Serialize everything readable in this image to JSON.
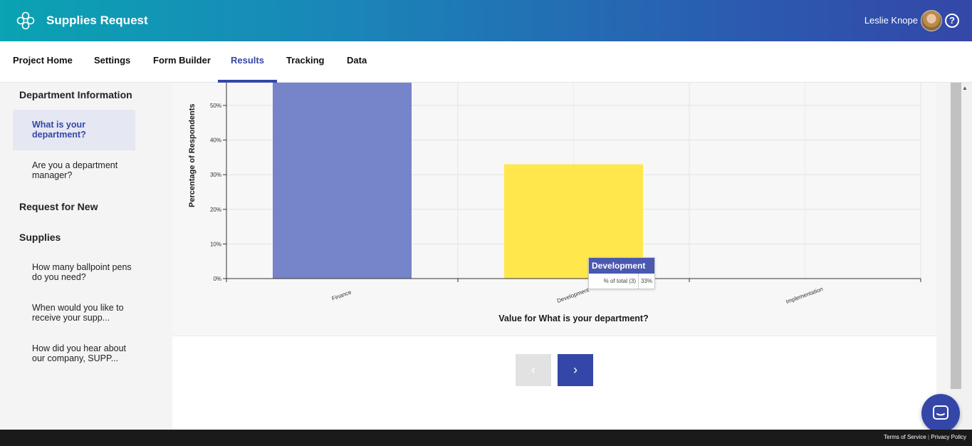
{
  "header": {
    "app_title": "Supplies Request",
    "user_name": "Leslie Knope",
    "help_icon": "question-circle-icon",
    "logo_icon": "flower-logo-icon"
  },
  "nav": {
    "tabs": [
      {
        "label": "Project Home"
      },
      {
        "label": "Settings"
      },
      {
        "label": "Form Builder"
      },
      {
        "label": "Results",
        "active": true
      },
      {
        "label": "Tracking"
      },
      {
        "label": "Data"
      }
    ]
  },
  "sidebar": {
    "sections": [
      {
        "title": "Department Information",
        "items": [
          {
            "label": "What is your department?",
            "active": true
          },
          {
            "label": "Are you a department manager?"
          }
        ]
      },
      {
        "title": "Request for New",
        "title2": "Supplies",
        "items": [
          {
            "label": "How many ballpoint pens do you need?"
          },
          {
            "label": "When would you like to receive your supp..."
          },
          {
            "label": "How did you hear about our company, SUPP..."
          }
        ]
      }
    ]
  },
  "chart_data": {
    "type": "bar",
    "categories": [
      "Finance",
      "Development",
      "Implementation"
    ],
    "values": [
      57,
      33,
      0
    ],
    "colors": [
      "#7684c9",
      "#ffe74c",
      "#cccccc"
    ],
    "ylabel": "Percentage of Respondents",
    "xlabel": "Value for What is your department?",
    "ylim": [
      0,
      55
    ],
    "yticks": [
      "0%",
      "10%",
      "20%",
      "30%",
      "40%",
      "50%"
    ],
    "grid": true,
    "tooltip": {
      "title": "Development",
      "row_label": "% of total (3)",
      "row_value": "33%"
    }
  },
  "pager": {
    "prev_icon": "chevron-left-icon",
    "next_icon": "chevron-right-icon",
    "prev_glyph": "‹",
    "next_glyph": "›"
  },
  "footer": {
    "terms": "Terms of Service",
    "separator": "|",
    "privacy": "Privacy Policy"
  },
  "colors": {
    "accent": "#3447a8",
    "finance_bar": "#7684c9",
    "development_bar": "#ffe74c"
  }
}
